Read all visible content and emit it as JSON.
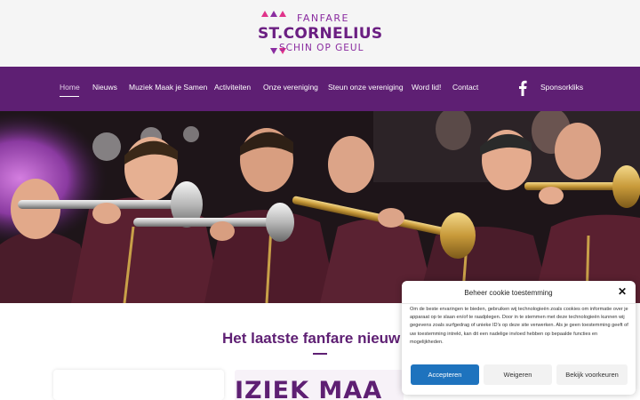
{
  "logo": {
    "line1": "FANFARE",
    "line2": "ST.CORNELIUS",
    "line3": "SCHIN OP GEUL",
    "colors": {
      "primary": "#6b1f82",
      "accent": "#e0338a"
    }
  },
  "nav": {
    "items": [
      {
        "label": "Home",
        "active": true
      },
      {
        "label": "Nieuws"
      },
      {
        "label": "Muziek Maak je Samen"
      },
      {
        "label": "Activiteiten"
      },
      {
        "label": "Onze vereniging"
      },
      {
        "label": "Steun onze vereniging"
      },
      {
        "label": "Word lid!"
      },
      {
        "label": "Contact"
      }
    ],
    "facebook_icon": "facebook-icon",
    "sponsor_label": "Sponsorkliks",
    "background": "#5e1f73"
  },
  "hero": {
    "image": "hero-photo-trumpet-players"
  },
  "section": {
    "title": "Het laatste fanfare nieuw",
    "card2_text": "IZIEK MAA"
  },
  "cookie": {
    "title": "Beheer cookie toestemming",
    "body": "Om de beste ervaringen te bieden, gebruiken wij technologieën zoals cookies om informatie over je apparaat op te slaan en/of te raadplegen. Door in te stemmen met deze technologieën kunnen wij gegevens zoals surfgedrag of unieke ID's op deze site verwerken. Als je geen toestemming geeft of uw toestemming intrekt, kan dit een nadelige invloed hebben op bepaalde functies en mogelijkheden.",
    "accept_label": "Accepteren",
    "deny_label": "Weigeren",
    "prefs_label": "Bekijk voorkeuren",
    "close_icon": "close-icon",
    "accept_color": "#1e73be"
  }
}
